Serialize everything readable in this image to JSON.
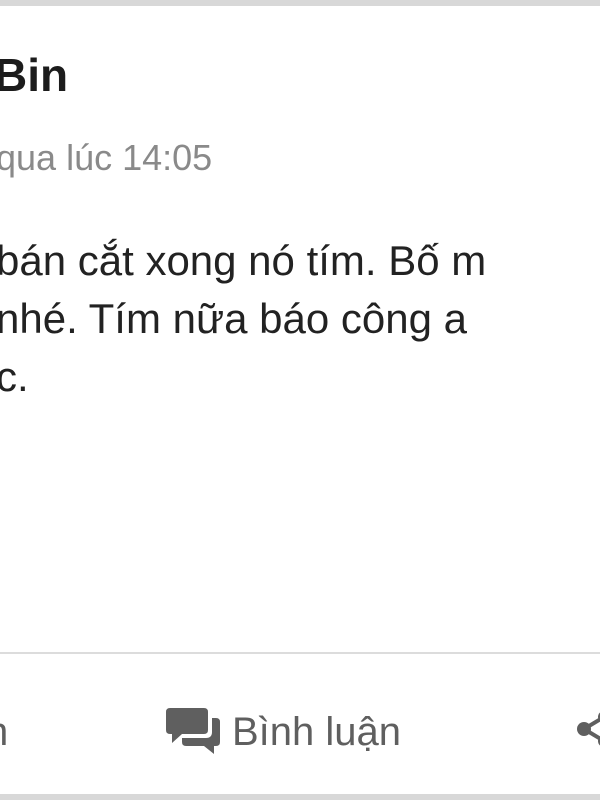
{
  "post": {
    "author": "Bin",
    "timestamp": "qua lúc 14:05",
    "body_lines": [
      "bán cắt xong nó tím. Bố m",
      "nhé. Tím nữa báo công a",
      "c."
    ]
  },
  "actions": {
    "like_label_fragment": "n",
    "comment_label": "Bình luận",
    "comment_icon": "comment-bubbles-icon",
    "share_icon": "share-icon"
  },
  "colors": {
    "text_primary": "#222222",
    "text_secondary": "#8a8a8a",
    "action_gray": "#5f5f5f",
    "divider": "#dcdcdc"
  }
}
